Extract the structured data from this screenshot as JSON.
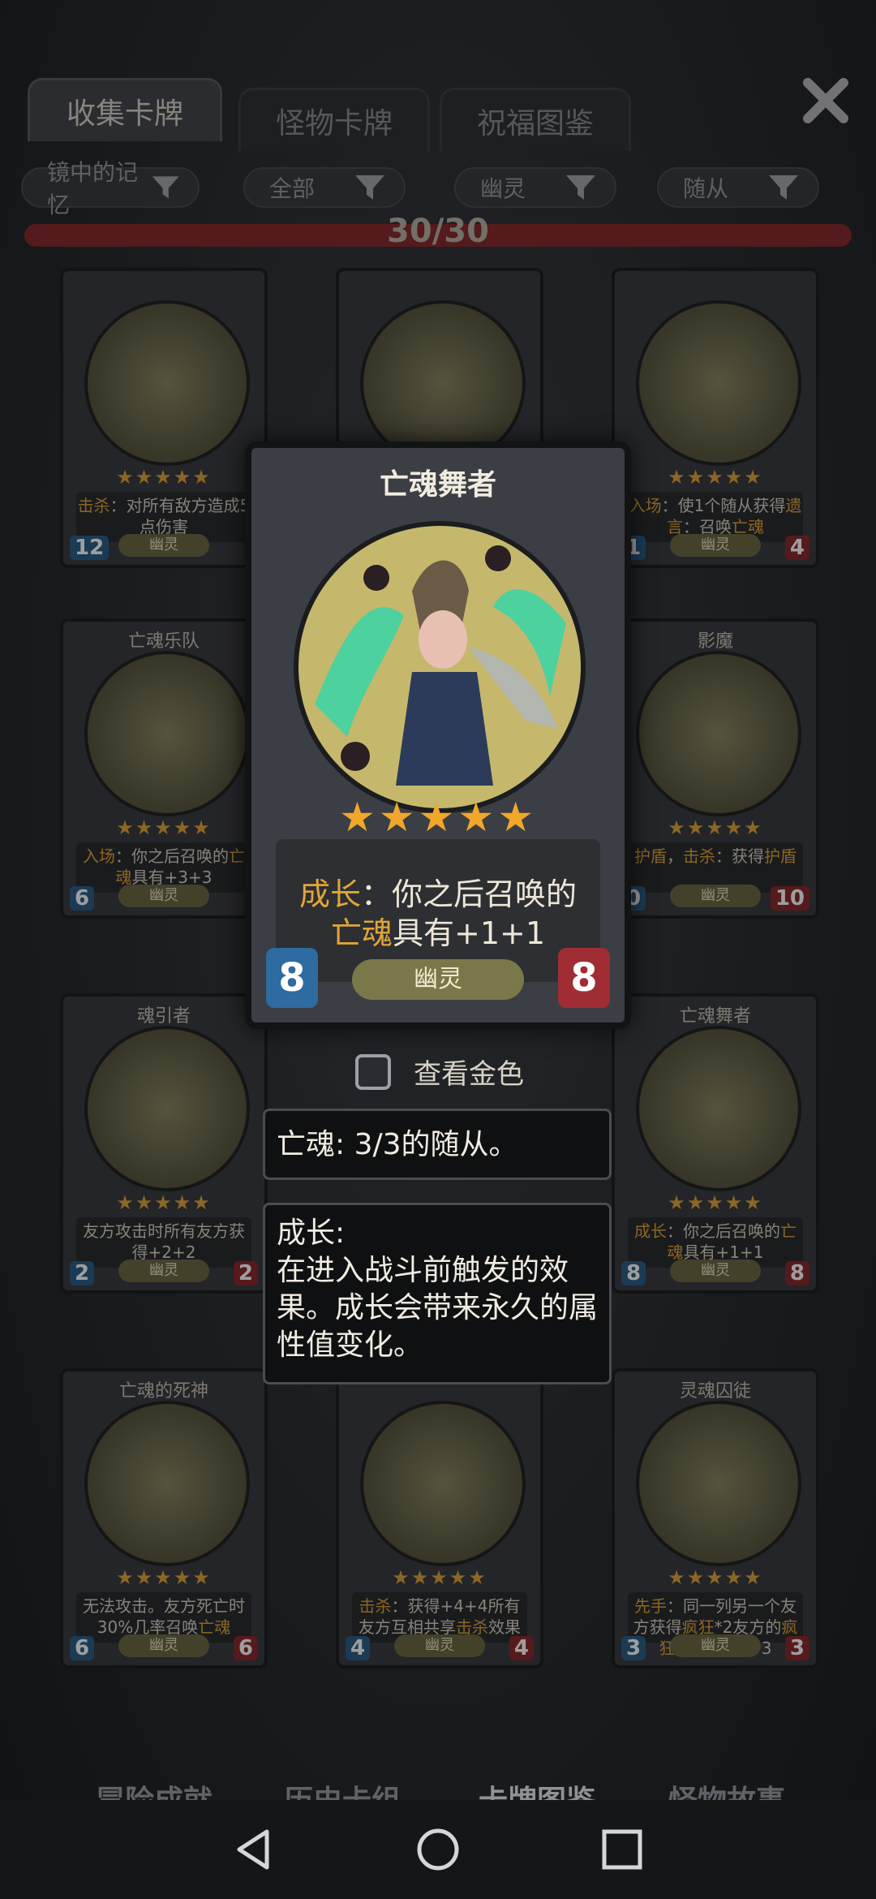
{
  "tabs": [
    {
      "label": "收集卡牌",
      "active": true
    },
    {
      "label": "怪物卡牌",
      "active": false
    },
    {
      "label": "祝福图鉴",
      "active": false
    }
  ],
  "filters": [
    "镜中的记忆",
    "全部",
    "幽灵",
    "随从"
  ],
  "progress": {
    "label": "30/30",
    "value": 1.0
  },
  "cards": [
    {
      "name": "",
      "desc_parts": [
        [
          "击杀",
          true
        ],
        [
          "：对所有敌方造成5点伤害",
          false
        ]
      ],
      "attack": "12",
      "health": "",
      "tribe": "幽灵"
    },
    {
      "name": "",
      "desc_parts": [],
      "attack": "",
      "health": "",
      "tribe": ""
    },
    {
      "name": "",
      "desc_parts": [
        [
          "入场",
          true
        ],
        [
          "：使1个随从获得",
          false
        ],
        [
          "遗言",
          true
        ],
        [
          "：召唤",
          false
        ],
        [
          "亡魂",
          true
        ]
      ],
      "attack": "1",
      "health": "4",
      "tribe": "幽灵"
    },
    {
      "name": "亡魂乐队",
      "desc_parts": [
        [
          "入场",
          true
        ],
        [
          "：你之后召唤的",
          false
        ],
        [
          "亡魂",
          true
        ],
        [
          "具有+3+3",
          false
        ]
      ],
      "attack": "6",
      "health": "",
      "tribe": "幽灵"
    },
    {
      "name": "影魔",
      "desc_parts": [
        [
          "护盾",
          true
        ],
        [
          "，",
          false
        ],
        [
          "击杀",
          true
        ],
        [
          "：获得",
          false
        ],
        [
          "护盾",
          true
        ]
      ],
      "attack": "0",
      "health": "10",
      "tribe": "幽灵"
    },
    {
      "name": "魂引者",
      "desc_parts": [
        [
          "友方攻击时所有友方获得+2+2",
          false
        ]
      ],
      "attack": "2",
      "health": "2",
      "tribe": "幽灵"
    },
    {
      "name": "亡魂舞者",
      "desc_parts": [
        [
          "成长",
          true
        ],
        [
          "：你之后召唤的",
          false
        ],
        [
          "亡魂",
          true
        ],
        [
          "具有+1+1",
          false
        ]
      ],
      "attack": "8",
      "health": "8",
      "tribe": "幽灵"
    },
    {
      "name": "亡魂的死神",
      "desc_parts": [
        [
          "无法攻击。友方死亡时30%几率召唤",
          false
        ],
        [
          "亡魂",
          true
        ]
      ],
      "attack": "6",
      "health": "6",
      "tribe": "幽灵"
    },
    {
      "name": "",
      "desc_parts": [
        [
          "击杀",
          true
        ],
        [
          "：获得+4+4所有友方互相共享",
          false
        ],
        [
          "击杀",
          true
        ],
        [
          "效果",
          false
        ]
      ],
      "attack": "4",
      "health": "4",
      "tribe": "幽灵"
    },
    {
      "name": "灵魂囚徒",
      "desc_parts": [
        [
          "先手",
          true
        ],
        [
          "：同一列另一个友方获得",
          false
        ],
        [
          "疯狂",
          true
        ],
        [
          "*2友方的",
          false
        ],
        [
          "疯狂",
          true
        ],
        [
          "使友方+3+3",
          false
        ]
      ],
      "attack": "3",
      "health": "3",
      "tribe": "幽灵"
    }
  ],
  "selected_card": {
    "name": "亡魂舞者",
    "stars": "★★★★★",
    "desc_key": "成长",
    "desc_rest1": "：你之后召唤的",
    "desc_key2": "亡魂",
    "desc_rest2": "具有+1+1",
    "attack": "8",
    "health": "8",
    "tribe": "幽灵"
  },
  "gold_toggle_label": "查看金色",
  "tooltips": [
    {
      "text": "亡魂: 3/3的随从。"
    },
    {
      "text": "成长:\n在进入战斗前触发的效果。成长会带来永久的属性值变化。"
    }
  ],
  "bottom_nav": [
    "冒险成就",
    "历史卡组",
    "卡牌图鉴",
    "怪物故事"
  ],
  "colors": {
    "accent": "#e0a53a",
    "health": "#a02d34",
    "attack": "#2d6ba0"
  }
}
